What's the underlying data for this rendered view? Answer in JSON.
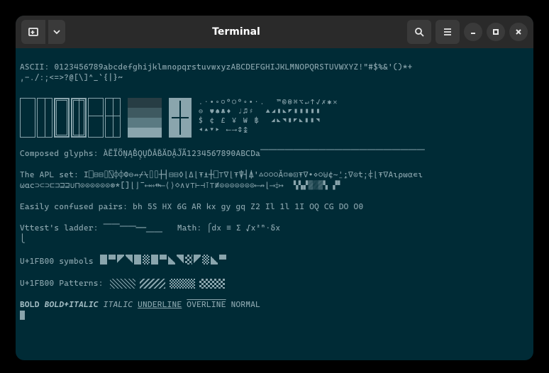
{
  "window": {
    "title": "Terminal"
  },
  "lines": {
    "ascii_label": "ASCII: ",
    "ascii": "0123456789abcdefghijklmnopqrstuvwxyzABCDEFGHIJKLMNOPQRSTUVWXYZ!\"#$%&'()*+",
    "ascii2": ",-./:;<=>?@[\\]^_`{|}~",
    "symrow1": ".·•◦○°◯°◦•·.  ™©®⌘⌥↵↑✓✗✱✕",
    "symrow2": "⊖ ♥♠♣♦ ♩♫♯  ▲◢▮◣◤▮▮▮▮▮",
    "symrow3": "$ ¢ £ ¥ ₩ ฿  ◢◣◥▮◤◣▮▮◥",
    "symrow4": "◂▴▾▸ ⟵⟶↕↨    ",
    "comp_label": "Composed glyphs: ",
    "comp": "ÀĒĨÕŅĄB̊Q̣ŲD̂ÂB̌ĂD̨ÂJ̃Ã1234567890ABCDa⎺⎺⎺⎺⎺⎺⎺⎺⎺⎺⎺⎺⎺⎺⎺⎺⎺⎺⎺⎺",
    "apl_label": "The APL set: ",
    "apl1": "I⎕⊟⊟⌷⍂⌽⌽Φ⊖↛⌿⍀⌷⌷┼┤⊟⊟◊⌊∆⌊⍕⍎┼⎕⊤∇⌊⍕⍒┤⍋'△○○○Ǎ◻⊚⊡⍕∇•⋄○⊎¢∼⍘⍮∇⊙t;⍧⌊⍕∇Αιρω⍺∊ι",
    "apl2": "⍵αс⊃⊂⊃⊏⊐⊒⊒∪⊓⊙⊙⊙⊙⊙⊙⊛*[]⌊⌋¯⟷⇔↔⟵⟨⟩◇∧∨⊤⊢⊣⊺⊤≢⊙⊙⊙⊙⊙⊙⊙⟵↛⌊⟶⤈↦  ▚▚▞▓▒▓▚ ▞▘ ",
    "conf_label": "Easily confused pairs: ",
    "conf": "bh 5S HX 6G AR kx gy gq Z2 Il 1l 1I OQ CG DO O0",
    "vt_label": "Vttest's ladder: ",
    "vt": "⎺⎺⎻⎻──⎽⎽",
    "math_label": "   Math: ",
    "math": "⎧dx ≡ Σ √x²ⁿ·δx\n⎩",
    "u1fb_sym_label": "U+1FB00 symbols ",
    "u1fb_pat_label": "U+1FB00 Patterns: ",
    "bold": "BOLD",
    "bolditalic": "BOLD+ITALIC",
    "italic": "ITALIC",
    "underline": "UNDERLINE",
    "overline": "OVERLINE",
    "normal": "NORMAL"
  }
}
